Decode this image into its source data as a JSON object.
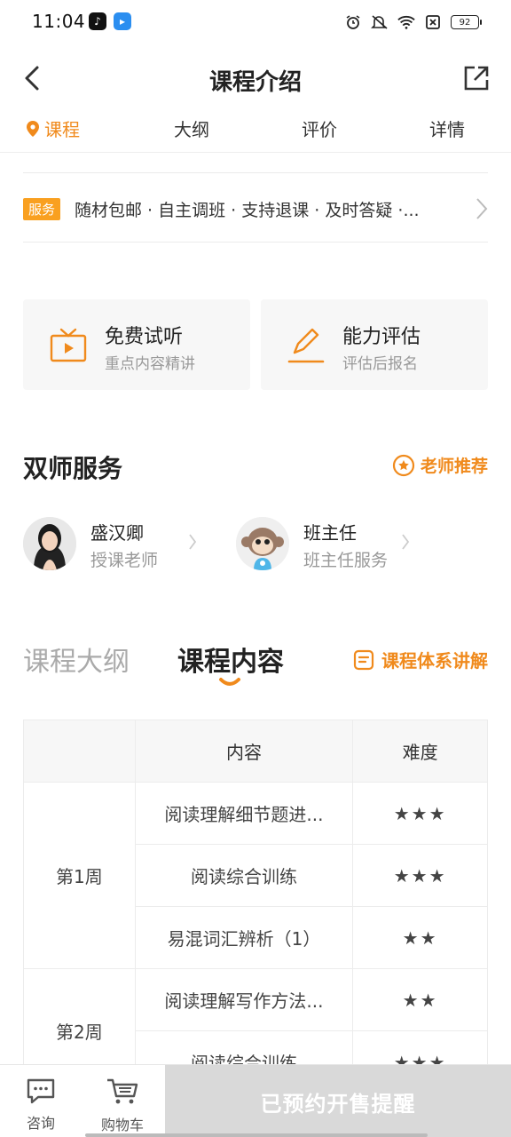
{
  "status_bar": {
    "time": "11:04",
    "battery": "92"
  },
  "header": {
    "title": "课程介绍"
  },
  "tabs": [
    {
      "label": "课程",
      "active": true
    },
    {
      "label": "大纲",
      "active": false
    },
    {
      "label": "评价",
      "active": false
    },
    {
      "label": "详情",
      "active": false
    }
  ],
  "service": {
    "badge": "服务",
    "text": "随材包邮 · 自主调班 · 支持退课 · 及时答疑 ·..."
  },
  "features": [
    {
      "title": "免费试听",
      "subtitle": "重点内容精讲",
      "icon": "tv-play-icon"
    },
    {
      "title": "能力评估",
      "subtitle": "评估后报名",
      "icon": "pencil-icon"
    }
  ],
  "dual_teacher": {
    "title": "双师服务",
    "recommend_label": "老师推荐",
    "teachers": [
      {
        "name": "盛汉卿",
        "role": "授课老师"
      },
      {
        "name": "班主任",
        "role": "班主任服务"
      }
    ]
  },
  "outline": {
    "tab_outline": "课程大纲",
    "tab_content": "课程内容",
    "system_link": "课程体系讲解"
  },
  "table": {
    "headers": [
      "",
      "内容",
      "难度"
    ],
    "weeks": [
      {
        "week": "第1周",
        "rows": [
          {
            "content": "阅读理解细节题进...",
            "stars": "★★★",
            "difficulty": 3
          },
          {
            "content": "阅读综合训练",
            "stars": "★★★",
            "difficulty": 3
          },
          {
            "content": "易混词汇辨析（1）",
            "stars": "★★",
            "difficulty": 2
          }
        ]
      },
      {
        "week": "第2周",
        "rows": [
          {
            "content": "阅读理解写作方法...",
            "stars": "★★",
            "difficulty": 2
          },
          {
            "content": "阅读综合训练",
            "stars": "★★★",
            "difficulty": 3
          }
        ]
      }
    ]
  },
  "bottom_bar": {
    "consult": "咨询",
    "cart": "购物车",
    "cta": "已预约开售提醒"
  },
  "colors": {
    "accent": "#f08a1c",
    "star": "#f9c942",
    "cta_disabled": "#d9d9d9"
  }
}
